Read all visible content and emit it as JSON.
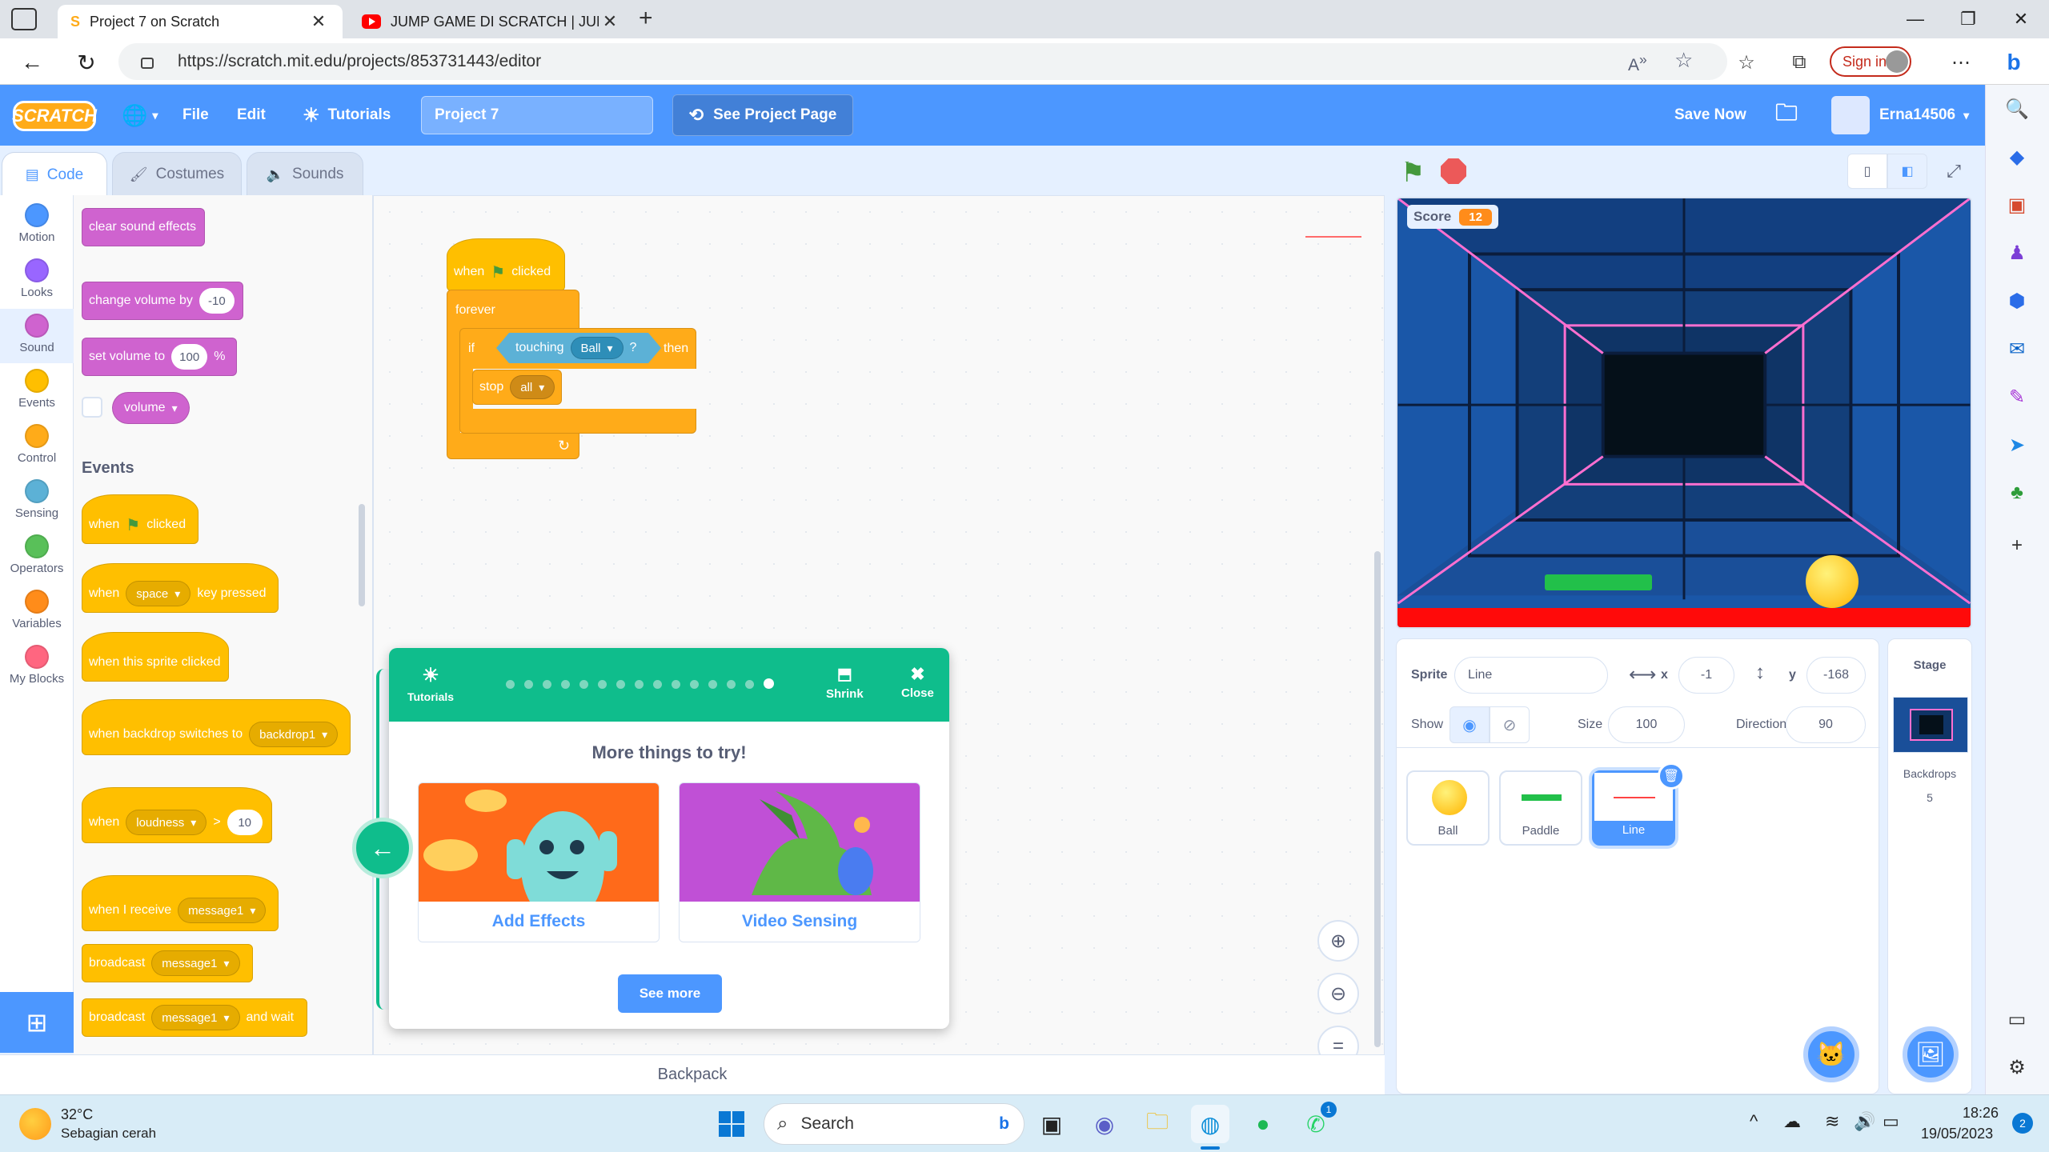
{
  "browser": {
    "tabs": [
      {
        "title": "Project 7 on Scratch",
        "active": true
      },
      {
        "title": "JUMP GAME DI SCRATCH | JUMP",
        "active": false
      }
    ],
    "url": "https://scratch.mit.edu/projects/853731443/editor",
    "sign_in_label": "Sign in"
  },
  "menubar": {
    "logo": "SCRATCH",
    "file": "File",
    "edit": "Edit",
    "tutorials": "Tutorials",
    "project_title": "Project 7",
    "see_project_page": "See Project Page",
    "save_now": "Save Now",
    "username": "Erna14506"
  },
  "editor_tabs": [
    "Code",
    "Costumes",
    "Sounds"
  ],
  "categories": [
    {
      "label": "Motion",
      "color": "#4c97ff"
    },
    {
      "label": "Looks",
      "color": "#9966ff"
    },
    {
      "label": "Sound",
      "color": "#cf63cf"
    },
    {
      "label": "Events",
      "color": "#ffbf00"
    },
    {
      "label": "Control",
      "color": "#ffab19"
    },
    {
      "label": "Sensing",
      "color": "#5cb1d6"
    },
    {
      "label": "Operators",
      "color": "#59c059"
    },
    {
      "label": "Variables",
      "color": "#ff8c1a"
    },
    {
      "label": "My Blocks",
      "color": "#ff6680"
    }
  ],
  "palette": {
    "clear_sound_effects": "clear sound effects",
    "change_volume_by": "change volume by",
    "change_volume_val": "-10",
    "set_volume_to": "set volume to",
    "set_volume_val": "100",
    "percent": "%",
    "volume": "volume",
    "events_title": "Events",
    "when": "when",
    "clicked": "clicked",
    "space": "space",
    "key_pressed": "key pressed",
    "when_sprite_clicked": "when this sprite clicked",
    "when_backdrop_switches_to": "when backdrop switches to",
    "backdrop1": "backdrop1",
    "loudness": "loudness",
    "gt": ">",
    "loudness_val": "10",
    "when_i_receive": "when I receive",
    "message1": "message1",
    "broadcast": "broadcast",
    "and_wait": "and wait"
  },
  "script": {
    "when": "when",
    "clicked": "clicked",
    "forever": "forever",
    "if": "if",
    "touching": "touching",
    "ball": "Ball",
    "question": "?",
    "then": "then",
    "stop": "stop",
    "all": "all"
  },
  "tutorial": {
    "tutorials_label": "Tutorials",
    "shrink": "Shrink",
    "close": "Close",
    "title": "More things to try!",
    "cards": [
      "Add Effects",
      "Video Sensing"
    ],
    "see_more": "See more",
    "steps_total": 15,
    "step_current": 15
  },
  "backpack": "Backpack",
  "stage": {
    "score_label": "Score",
    "score_value": "12"
  },
  "sprite_info": {
    "sprite_label": "Sprite",
    "sprite_name": "Line",
    "x_label": "x",
    "x_value": "-1",
    "y_label": "y",
    "y_value": "-168",
    "show_label": "Show",
    "size_label": "Size",
    "size_value": "100",
    "direction_label": "Direction",
    "direction_value": "90"
  },
  "sprites": [
    {
      "name": "Ball",
      "selected": false
    },
    {
      "name": "Paddle",
      "selected": false
    },
    {
      "name": "Line",
      "selected": true
    }
  ],
  "stage_pane": {
    "title": "Stage",
    "backdrops_label": "Backdrops",
    "backdrops_count": "5"
  },
  "taskbar": {
    "temp": "32°C",
    "weather": "Sebagian cerah",
    "search": "Search",
    "time": "18:26",
    "date": "19/05/2023",
    "notifications": "2",
    "whatsapp_badge": "1"
  }
}
